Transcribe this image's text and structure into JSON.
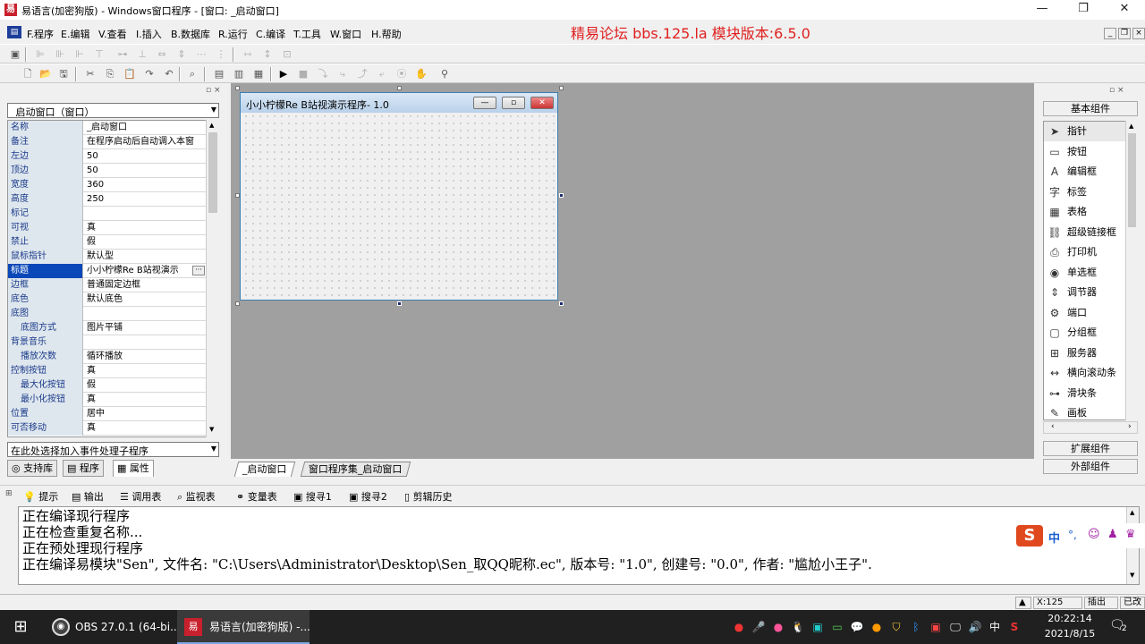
{
  "window": {
    "title": "易语言(加密狗版) - Windows窗口程序 - [窗口: _启动窗口]"
  },
  "menu": [
    "F.程序",
    "E.编辑",
    "V.查看",
    "I.插入",
    "B.数据库",
    "R.运行",
    "C.编译",
    "T.工具",
    "W.窗口",
    "H.帮助"
  ],
  "banner": "精易论坛 bbs.125.la 模块版本:6.5.0",
  "left_panel": {
    "object_combo": "_启动窗口（窗口）",
    "properties": [
      {
        "name": "名称",
        "value": "_启动窗口",
        "sub": false
      },
      {
        "name": "备注",
        "value": "在程序启动后自动调入本窗",
        "sub": false
      },
      {
        "name": "左边",
        "value": "50",
        "sub": false
      },
      {
        "name": "顶边",
        "value": "50",
        "sub": false
      },
      {
        "name": "宽度",
        "value": "360",
        "sub": false
      },
      {
        "name": "高度",
        "value": "250",
        "sub": false
      },
      {
        "name": "标记",
        "value": "",
        "sub": false
      },
      {
        "name": "可视",
        "value": "真",
        "sub": false
      },
      {
        "name": "禁止",
        "value": "假",
        "sub": false
      },
      {
        "name": "鼠标指针",
        "value": "默认型",
        "sub": false
      },
      {
        "name": "标题",
        "value": "小小柠檬Re  B站视演示",
        "sub": false,
        "selected": true
      },
      {
        "name": "边框",
        "value": "普通固定边框",
        "sub": false
      },
      {
        "name": "底色",
        "value": "默认底色",
        "sub": false
      },
      {
        "name": "底图",
        "value": "",
        "sub": false
      },
      {
        "name": "底图方式",
        "value": "图片平铺",
        "sub": true
      },
      {
        "name": "背景音乐",
        "value": "",
        "sub": false
      },
      {
        "name": "播放次数",
        "value": "循环播放",
        "sub": true
      },
      {
        "name": "控制按钮",
        "value": "真",
        "sub": false
      },
      {
        "name": "最大化按钮",
        "value": "假",
        "sub": true
      },
      {
        "name": "最小化按钮",
        "value": "真",
        "sub": true
      },
      {
        "name": "位置",
        "value": "居中",
        "sub": false
      },
      {
        "name": "可否移动",
        "value": "真",
        "sub": false
      }
    ],
    "event_combo": "在此处选择加入事件处理子程序",
    "tabs": [
      "支持库",
      "程序",
      "属性"
    ]
  },
  "designer": {
    "form_title": "小小柠檬Re  B站视演示程序- 1.0",
    "doc_tabs": [
      "_启动窗口",
      "窗口程序集_启动窗口"
    ]
  },
  "right_panel": {
    "header": "基本组件",
    "components": [
      {
        "label": "指针",
        "icon": "pointer-icon",
        "glyph": "➤"
      },
      {
        "label": "按钮",
        "icon": "button-icon",
        "glyph": "▭"
      },
      {
        "label": "编辑框",
        "icon": "editbox-icon",
        "glyph": "A"
      },
      {
        "label": "标签",
        "icon": "label-icon",
        "glyph": "字"
      },
      {
        "label": "表格",
        "icon": "table-icon",
        "glyph": "▦"
      },
      {
        "label": "超级链接框",
        "icon": "hyperlink-icon",
        "glyph": "⛓"
      },
      {
        "label": "打印机",
        "icon": "printer-icon",
        "glyph": "⎙"
      },
      {
        "label": "单选框",
        "icon": "radio-icon",
        "glyph": "◉"
      },
      {
        "label": "调节器",
        "icon": "spinner-icon",
        "glyph": "⇕"
      },
      {
        "label": "端口",
        "icon": "port-icon",
        "glyph": "⚙"
      },
      {
        "label": "分组框",
        "icon": "groupbox-icon",
        "glyph": "▢"
      },
      {
        "label": "服务器",
        "icon": "server-icon",
        "glyph": "⊞"
      },
      {
        "label": "横向滚动条",
        "icon": "hscroll-icon",
        "glyph": "↔"
      },
      {
        "label": "滑块条",
        "icon": "slider-icon",
        "glyph": "⊶"
      },
      {
        "label": "画板",
        "icon": "canvas-icon",
        "glyph": "✎"
      }
    ],
    "ext_button": "扩展组件",
    "ext2_button": "外部组件"
  },
  "output_tabs": [
    "提示",
    "输出",
    "调用表",
    "监视表",
    "变量表",
    "搜寻1",
    "搜寻2",
    "剪辑历史"
  ],
  "output_lines": [
    "正在编译现行程序",
    "正在检查重复名称...",
    "正在预处理现行程序",
    "正在编译易模块\"Sen\", 文件名: \"C:\\Users\\Administrator\\Desktop\\Sen_取QQ昵称.ec\", 版本号: \"1.0\", 创建号: \"0.0\", 作者: \"尴尬小王子\"."
  ],
  "ime": {
    "label": "中"
  },
  "status": {
    "coords": "X:125",
    "mode": "插出",
    "state": "已改"
  },
  "taskbar": {
    "tasks": [
      "OBS 27.0.1 (64-bi...",
      "易语言(加密狗版) -..."
    ],
    "time": "20:22:14",
    "date": "2021/8/15",
    "ime": "中",
    "notify_count": "2"
  }
}
